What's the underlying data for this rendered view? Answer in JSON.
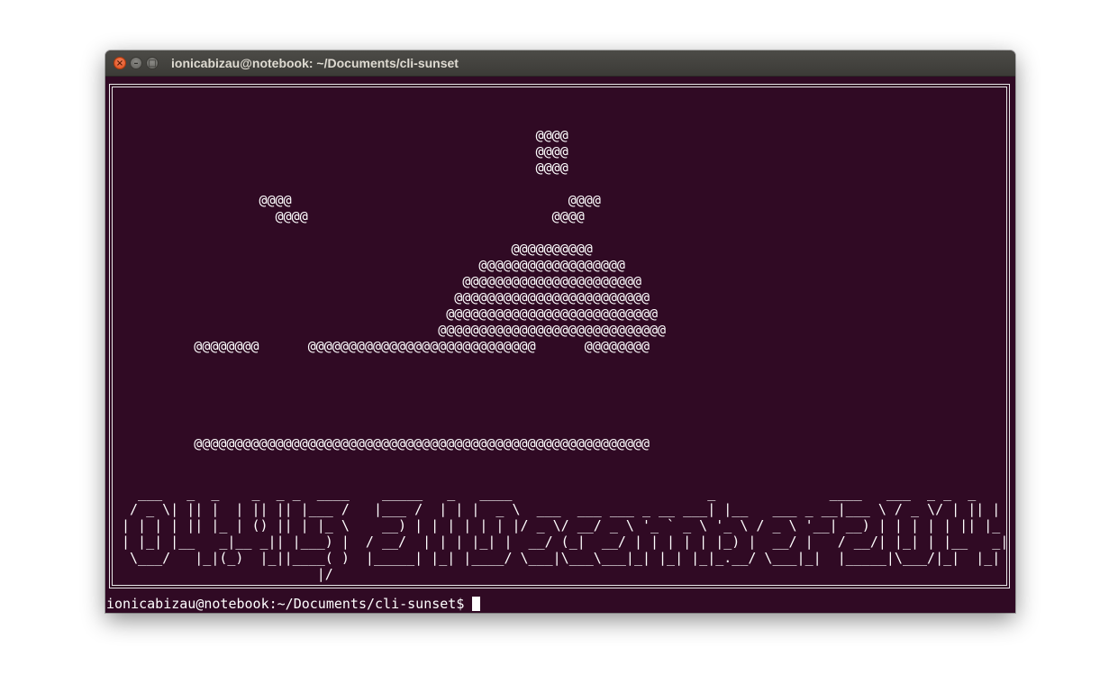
{
  "window": {
    "title": "ionicabizau@notebook: ~/Documents/cli-sunset",
    "background": "#300a24",
    "buttons": {
      "close": "×",
      "minimize": "–",
      "maximize": "□"
    }
  },
  "terminal": {
    "art": "                                                    @@@@\n                                                    @@@@\n                                                    @@@@\n\n                  @@@@                                  @@@@\n                    @@@@                              @@@@\n\n                                                 @@@@@@@@@@\n                                             @@@@@@@@@@@@@@@@@@\n                                           @@@@@@@@@@@@@@@@@@@@@@\n                                          @@@@@@@@@@@@@@@@@@@@@@@@\n                                         @@@@@@@@@@@@@@@@@@@@@@@@@@\n                                        @@@@@@@@@@@@@@@@@@@@@@@@@@@@\n          @@@@@@@@      @@@@@@@@@@@@@@@@@@@@@@@@@@@@      @@@@@@@@\n\n\n\n\n\n          @@@@@@@@@@@@@@@@@@@@@@@@@@@@@@@@@@@@@@@@@@@@@@@@@@@@@@@@",
    "banner": "  ___   _  _    _  _ _  ____    _____   _   ____                        _              ____   ___  _ _  _\n / _ \\| || |  | || || |___ /   |___ /  | | |  _ \\  ___  ___ ___ _ __ ___| |__   ___ _ __|___ \\ / _ \\/ | || |\n| | | | || |_ | () || | |_ \\    __) | | | | | | |/ _ \\/ __/ _ \\ '_ ` _ \\ '_ \\ / _ \\ '__| __) | | | | | || |_\n| |_| |__   _|__ _|| |___) |  / __/  | | | |_| |  __/ (_|  __/ | | | | | |_) |  __/ |   / __/| |_| | |__   _|\n \\___/   |_|(_)  |_||____( )  |_____| |_| |____/ \\___|\\___\\___|_| |_| |_|_.__/ \\___|_|  |_____|\\___/|_|  |_|\n                        |/",
    "prompt": "ionicabizau@notebook:~/Documents/cli-sunset$"
  }
}
